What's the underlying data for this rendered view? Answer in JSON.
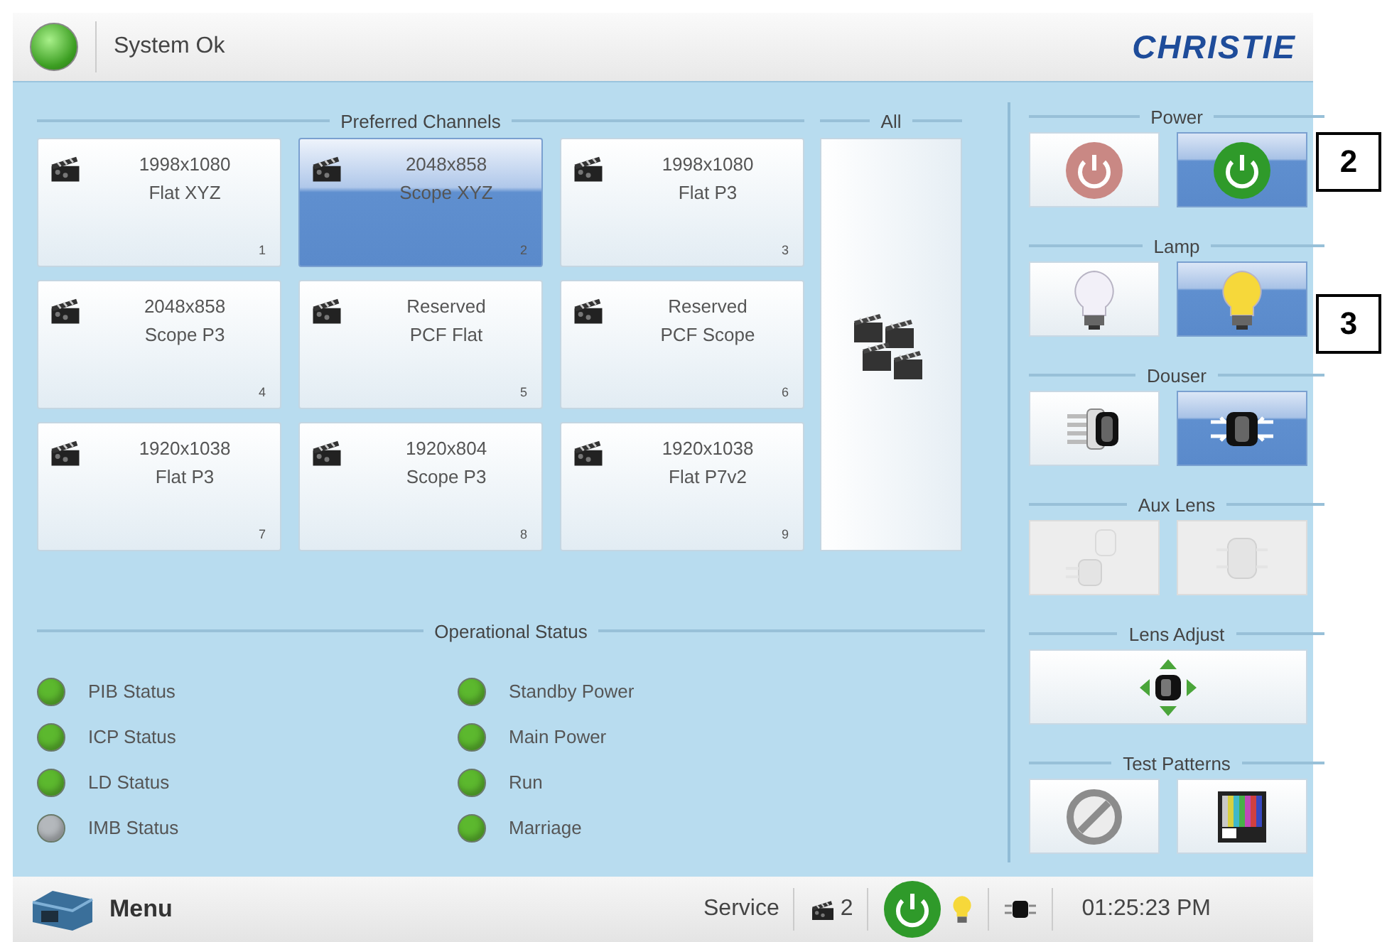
{
  "top_bar": {
    "status": "System Ok",
    "logo": "CHRISTIE"
  },
  "preferred_channels": {
    "title": "Preferred Channels",
    "channels": [
      {
        "line1": "1998x1080",
        "line2": "Flat XYZ",
        "number": "1",
        "selected": false
      },
      {
        "line1": "2048x858",
        "line2": "Scope XYZ",
        "number": "2",
        "selected": true
      },
      {
        "line1": "1998x1080",
        "line2": "Flat P3",
        "number": "3",
        "selected": false
      },
      {
        "line1": "2048x858",
        "line2": "Scope P3",
        "number": "4",
        "selected": false
      },
      {
        "line1": "Reserved",
        "line2": "PCF Flat",
        "number": "5",
        "selected": false
      },
      {
        "line1": "Reserved",
        "line2": "PCF Scope",
        "number": "6",
        "selected": false
      },
      {
        "line1": "1920x1038",
        "line2": "Flat P3",
        "number": "7",
        "selected": false
      },
      {
        "line1": "1920x804",
        "line2": "Scope P3",
        "number": "8",
        "selected": false
      },
      {
        "line1": "1920x1038",
        "line2": "Flat P7v2",
        "number": "9",
        "selected": false
      }
    ]
  },
  "all": {
    "title": "All"
  },
  "controls": [
    {
      "title": "Power",
      "buttons": [
        {
          "kind": "power-off",
          "selected": false,
          "disabled": false
        },
        {
          "kind": "power-on",
          "selected": true,
          "disabled": false
        }
      ]
    },
    {
      "title": "Lamp",
      "buttons": [
        {
          "kind": "lamp-off",
          "selected": false,
          "disabled": false
        },
        {
          "kind": "lamp-on",
          "selected": true,
          "disabled": false
        }
      ]
    },
    {
      "title": "Douser",
      "buttons": [
        {
          "kind": "douser-closed",
          "selected": false,
          "disabled": false
        },
        {
          "kind": "douser-open",
          "selected": true,
          "disabled": false
        }
      ]
    },
    {
      "title": "Aux Lens",
      "buttons": [
        {
          "kind": "lens-pair",
          "selected": false,
          "disabled": true
        },
        {
          "kind": "lens-single",
          "selected": false,
          "disabled": true
        }
      ]
    },
    {
      "title": "Lens Adjust",
      "buttons": [
        {
          "kind": "lens-adjust",
          "selected": false,
          "disabled": false
        }
      ]
    },
    {
      "title": "Test Patterns",
      "buttons": [
        {
          "kind": "pattern-none",
          "selected": false,
          "disabled": false
        },
        {
          "kind": "pattern-bars",
          "selected": false,
          "disabled": false
        }
      ]
    }
  ],
  "operational_status": {
    "title": "Operational Status",
    "columns": [
      [
        {
          "label": "PIB Status",
          "color": "#5cb82e"
        },
        {
          "label": "ICP Status",
          "color": "#5cb82e"
        },
        {
          "label": "LD Status",
          "color": "#5cb82e"
        },
        {
          "label": "IMB Status",
          "color": "#b4b8bc"
        }
      ],
      [
        {
          "label": "Standby Power",
          "color": "#5cb82e"
        },
        {
          "label": "Main Power",
          "color": "#5cb82e"
        },
        {
          "label": "Run",
          "color": "#5cb82e"
        },
        {
          "label": "Marriage",
          "color": "#5cb82e"
        }
      ]
    ]
  },
  "bottom_bar": {
    "menu": "Menu",
    "service": "Service",
    "channel": "2",
    "time": "01:25:23 PM"
  },
  "callouts": [
    "2",
    "3"
  ]
}
